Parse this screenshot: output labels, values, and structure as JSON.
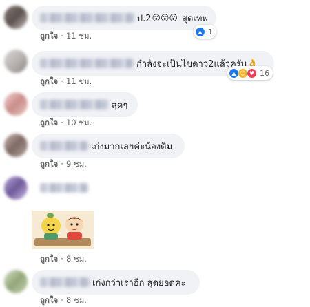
{
  "comments": [
    {
      "text": "ป.2",
      "emoji": "😮😮😮",
      "text2": "สุดเทพ",
      "like_label": "ถูกใจ",
      "time": "11 ชม.",
      "reaction_count": "1"
    },
    {
      "text": "กำลังจะเป็นไขดาว2แล้วครับ",
      "emoji": "👌",
      "like_label": "ถูกใจ",
      "time": "11 ชม.",
      "reaction_count": "16"
    },
    {
      "text": "สุดๆ",
      "like_label": "ถูกใจ",
      "time": "10 ชม."
    },
    {
      "text": "เก่งมากเลยค่ะน้องดิม",
      "like_label": "ถูกใจ",
      "time": "9 ชม."
    },
    {
      "like_label": "ถูกใจ",
      "time": "8 ชม."
    },
    {
      "text": "เก่งกว่าเราอีก สุดยอดคะ",
      "like_label": "ถูกใจ",
      "time": "8 ชม."
    }
  ],
  "colors": {
    "bubble": "#f0f2f5",
    "meta_text": "#65676b",
    "like_blue": "#1877f2"
  },
  "icons": [
    "like-icon",
    "haha-icon",
    "love-icon"
  ]
}
